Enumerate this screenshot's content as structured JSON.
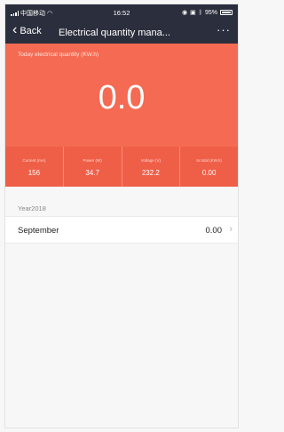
{
  "status_bar": {
    "carrier": "中国移动",
    "time": "16:52",
    "battery": "95%"
  },
  "nav": {
    "back_label": "Back",
    "title": "Electrical quantity mana...",
    "more": "···"
  },
  "hero": {
    "label": "Today electrical quantity (KW.h)",
    "value": "0.0",
    "stats": [
      {
        "label": "Current (mA)",
        "value": "156"
      },
      {
        "label": "Power (W)",
        "value": "34.7"
      },
      {
        "label": "Voltage (V)",
        "value": "232.2"
      },
      {
        "label": "In total (KW.h)",
        "value": "0.00"
      }
    ]
  },
  "history": {
    "year_label": "Year2018",
    "rows": [
      {
        "label": "September",
        "value": "0.00"
      }
    ]
  },
  "colors": {
    "nav_bg": "#2b2f3d",
    "accent": "#f46a52"
  }
}
